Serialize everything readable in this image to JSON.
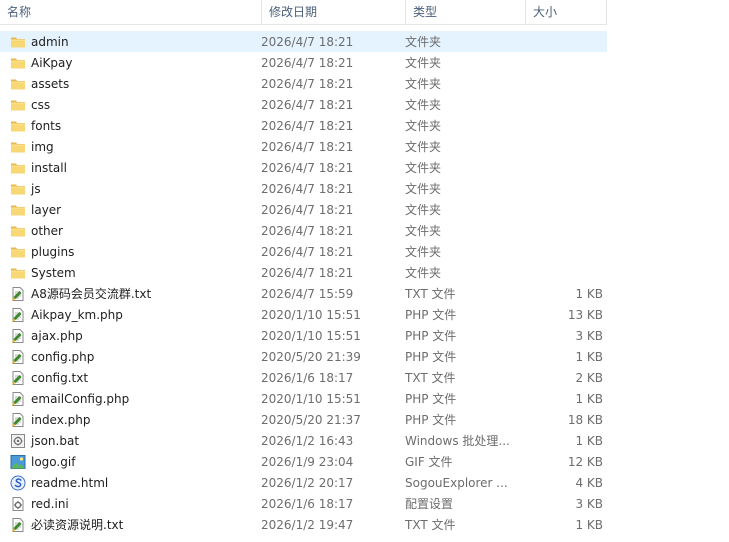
{
  "columns": {
    "name": "名称",
    "date": "修改日期",
    "type": "类型",
    "size": "大小"
  },
  "sort_indicator": "^",
  "files": [
    {
      "name": "admin",
      "date": "2026/4/7 18:21",
      "type": "文件夹",
      "size": "",
      "icon": "folder-icon"
    },
    {
      "name": "AiKpay",
      "date": "2026/4/7 18:21",
      "type": "文件夹",
      "size": "",
      "icon": "folder-icon"
    },
    {
      "name": "assets",
      "date": "2026/4/7 18:21",
      "type": "文件夹",
      "size": "",
      "icon": "folder-icon"
    },
    {
      "name": "css",
      "date": "2026/4/7 18:21",
      "type": "文件夹",
      "size": "",
      "icon": "folder-icon"
    },
    {
      "name": "fonts",
      "date": "2026/4/7 18:21",
      "type": "文件夹",
      "size": "",
      "icon": "folder-icon"
    },
    {
      "name": "img",
      "date": "2026/4/7 18:21",
      "type": "文件夹",
      "size": "",
      "icon": "folder-icon"
    },
    {
      "name": "install",
      "date": "2026/4/7 18:21",
      "type": "文件夹",
      "size": "",
      "icon": "folder-icon"
    },
    {
      "name": "js",
      "date": "2026/4/7 18:21",
      "type": "文件夹",
      "size": "",
      "icon": "folder-icon"
    },
    {
      "name": "layer",
      "date": "2026/4/7 18:21",
      "type": "文件夹",
      "size": "",
      "icon": "folder-icon"
    },
    {
      "name": "other",
      "date": "2026/4/7 18:21",
      "type": "文件夹",
      "size": "",
      "icon": "folder-icon"
    },
    {
      "name": "plugins",
      "date": "2026/4/7 18:21",
      "type": "文件夹",
      "size": "",
      "icon": "folder-icon"
    },
    {
      "name": "System",
      "date": "2026/4/7 18:21",
      "type": "文件夹",
      "size": "",
      "icon": "folder-icon"
    },
    {
      "name": "A8源码会员交流群.txt",
      "date": "2026/4/7 15:59",
      "type": "TXT 文件",
      "size": "1 KB",
      "icon": "text-file-icon"
    },
    {
      "name": "Aikpay_km.php",
      "date": "2020/1/10 15:51",
      "type": "PHP 文件",
      "size": "13 KB",
      "icon": "text-file-icon"
    },
    {
      "name": "ajax.php",
      "date": "2020/1/10 15:51",
      "type": "PHP 文件",
      "size": "3 KB",
      "icon": "text-file-icon"
    },
    {
      "name": "config.php",
      "date": "2020/5/20 21:39",
      "type": "PHP 文件",
      "size": "1 KB",
      "icon": "text-file-icon"
    },
    {
      "name": "config.txt",
      "date": "2026/1/6 18:17",
      "type": "TXT 文件",
      "size": "2 KB",
      "icon": "text-file-icon"
    },
    {
      "name": "emailConfig.php",
      "date": "2020/1/10 15:51",
      "type": "PHP 文件",
      "size": "1 KB",
      "icon": "text-file-icon"
    },
    {
      "name": "index.php",
      "date": "2020/5/20 21:37",
      "type": "PHP 文件",
      "size": "18 KB",
      "icon": "text-file-icon"
    },
    {
      "name": "json.bat",
      "date": "2026/1/2 16:43",
      "type": "Windows 批处理...",
      "size": "1 KB",
      "icon": "batch-file-icon"
    },
    {
      "name": "logo.gif",
      "date": "2026/1/9 23:04",
      "type": "GIF 文件",
      "size": "12 KB",
      "icon": "image-file-icon"
    },
    {
      "name": "readme.html",
      "date": "2026/1/2 20:17",
      "type": "SogouExplorer ...",
      "size": "4 KB",
      "icon": "browser-file-icon"
    },
    {
      "name": "red.ini",
      "date": "2026/1/6 18:17",
      "type": "配置设置",
      "size": "3 KB",
      "icon": "settings-file-icon"
    },
    {
      "name": "必读资源说明.txt",
      "date": "2026/1/2 19:47",
      "type": "TXT 文件",
      "size": "1 KB",
      "icon": "text-file-icon"
    }
  ],
  "hovered_row": 0,
  "colors": {
    "hover_bg": "#e5f3ff",
    "header_text": "#4c607a",
    "secondary_text": "#6d6d6d",
    "folder_yellow": "#f8d775"
  }
}
